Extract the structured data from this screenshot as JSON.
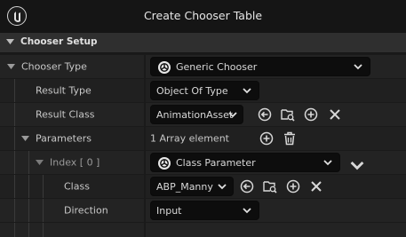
{
  "window": {
    "title": "Create Chooser Table"
  },
  "section": {
    "title": "Chooser Setup"
  },
  "rows": {
    "chooser_type": {
      "label": "Chooser Type",
      "value": "Generic Chooser"
    },
    "result_type": {
      "label": "Result Type",
      "value": "Object Of Type"
    },
    "result_class": {
      "label": "Result Class",
      "value": "AnimationAsset"
    },
    "parameters": {
      "label": "Parameters",
      "value": "1 Array element"
    },
    "index0": {
      "label": "Index [ 0 ]",
      "value": "Class Parameter"
    },
    "class": {
      "label": "Class",
      "value": "ABP_Manny"
    },
    "direction": {
      "label": "Direction",
      "value": "Input"
    }
  },
  "icons": {
    "use_selected": "back-arrow-icon",
    "browse": "folder-search-icon",
    "add": "plus-circle-icon",
    "clear": "close-icon",
    "delete": "trash-icon",
    "unreal_logo": "unreal-logo-icon"
  }
}
